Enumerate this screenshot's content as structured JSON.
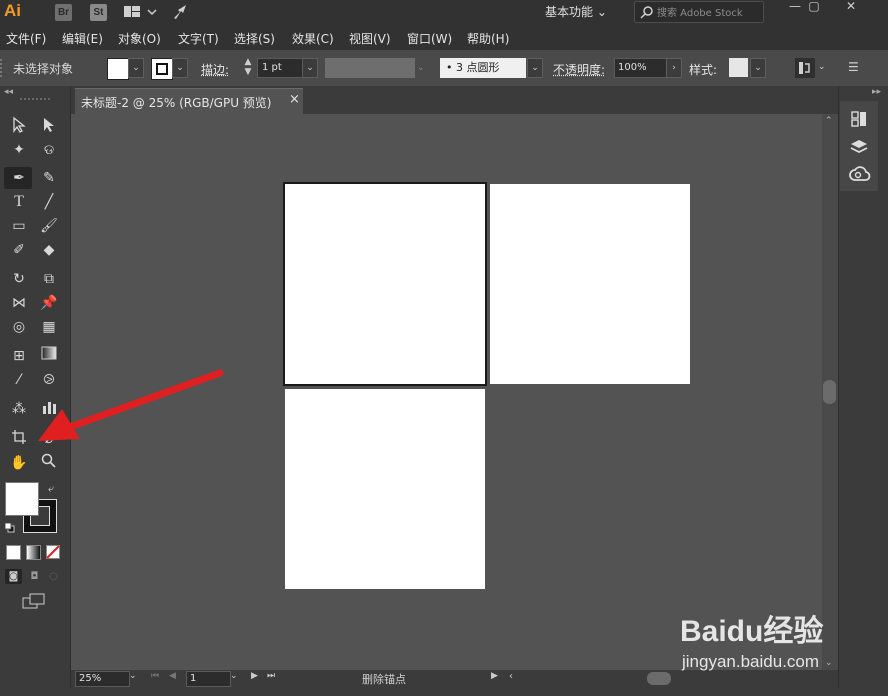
{
  "app": {
    "logo": "Ai",
    "bridge_label": "Br",
    "stock_label": "St",
    "workspace": "基本功能",
    "search_placeholder": "搜索 Adobe Stock"
  },
  "menus": [
    "文件(F)",
    "编辑(E)",
    "对象(O)",
    "文字(T)",
    "选择(S)",
    "效果(C)",
    "视图(V)",
    "窗口(W)",
    "帮助(H)"
  ],
  "control_bar": {
    "selection_status": "未选择对象",
    "stroke_label": "描边:",
    "stroke_weight": "1 pt",
    "brush": "3 点圆形",
    "opacity_label": "不透明度:",
    "opacity": "100%",
    "style_label": "样式:"
  },
  "document": {
    "tab_title": "未标题-2 @ 25% (RGB/GPU 预览)",
    "tab_close": "×"
  },
  "status_bar": {
    "zoom": "25%",
    "artboard_number": "1",
    "status_text": "删除锚点"
  },
  "watermark": {
    "brand": "Baidu经验",
    "url": "jingyan.baidu.com"
  },
  "colors": {
    "accent_logo": "#f59a23",
    "arrow": "#e02020",
    "artboard": "#ffffff",
    "canvas": "#535353"
  },
  "icons": [
    "selection-tool-icon",
    "direct-selection-tool-icon",
    "magic-wand-icon",
    "lasso-icon",
    "pen-tool-icon",
    "curvature-tool-icon",
    "type-tool-icon",
    "line-tool-icon",
    "rectangle-tool-icon",
    "paintbrush-icon",
    "shaper-tool-icon",
    "eraser-icon",
    "rotate-icon",
    "scale-icon",
    "width-tool-icon",
    "puppet-warp-icon",
    "shape-builder-icon",
    "perspective-grid-icon",
    "mesh-icon",
    "gradient-icon",
    "eyedropper-icon",
    "blend-icon",
    "symbol-sprayer-icon",
    "graph-icon",
    "artboard-tool-icon",
    "slice-icon",
    "hand-icon",
    "zoom-icon"
  ]
}
